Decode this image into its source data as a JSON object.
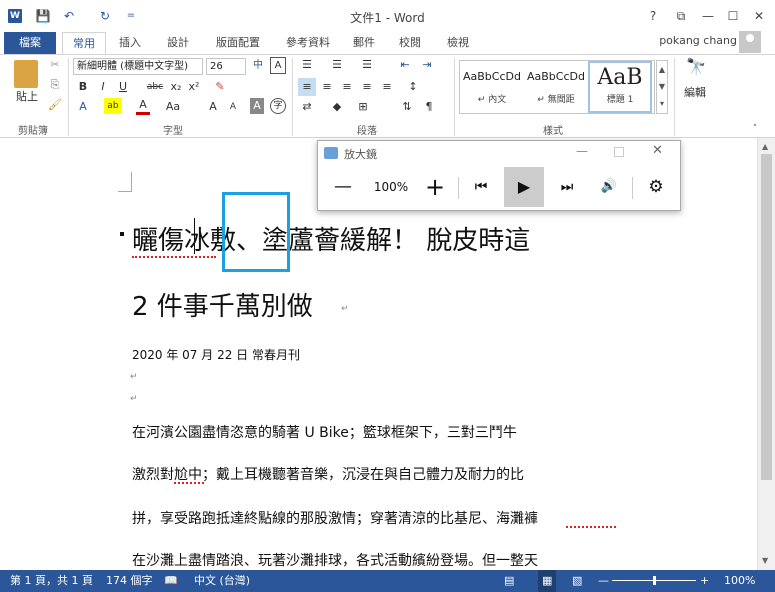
{
  "window": {
    "title": "文件1 - Word",
    "help": "?",
    "controls": [
      "⧉",
      "—",
      "☐",
      "✕"
    ]
  },
  "qat": [
    "💾",
    "↶",
    "↻",
    "="
  ],
  "ribbon_tabs": {
    "file": "檔案",
    "tabs": [
      "常用",
      "插入",
      "設計",
      "版面配置",
      "參考資料",
      "郵件",
      "校閱",
      "檢視"
    ],
    "user": "pokang chang"
  },
  "ribbon": {
    "clipboard": {
      "paste": "貼上",
      "label": "剪貼簿"
    },
    "font": {
      "name": "新細明體 (標題中文字型)",
      "size": "26",
      "label": "字型",
      "row2": [
        "B",
        "I",
        "U",
        "abc",
        "x₂",
        "x²",
        "✎"
      ],
      "row3": [
        "A",
        "ab",
        "A",
        "Aa",
        "A",
        "A",
        "A",
        "字"
      ]
    },
    "paragraph": {
      "label": "段落"
    },
    "styles": {
      "label": "樣式",
      "items": [
        {
          "sample": "AaBbCcDd",
          "name": "↵ 內文"
        },
        {
          "sample": "AaBbCcDd",
          "name": "↵ 無間距"
        },
        {
          "sample": "AaB",
          "name": "標題 1"
        }
      ]
    },
    "editing": {
      "label": "編輯"
    }
  },
  "document": {
    "heading_line1": "曬傷冰敷、塗蘆薈緩解！ 脫皮時這",
    "heading_line2": "2 件事千萬別做",
    "date_line": "2020 年 07 月 22 日 常春月刊",
    "paragraphs": [
      "在河濱公園盡情恣意的騎著 U Bike；籃球框架下，三對三鬥牛",
      "激烈對尬中；戴上耳機聽著音樂，沉浸在與自己體力及耐力的比",
      "拼，享受路跑抵達終點線的那股激情；穿著清涼的比基尼、海灘褲",
      "在沙灘上盡情踏浪、玩著沙灘排球，各式活動繽紛登場。但一整天"
    ],
    "para_mark": "↵"
  },
  "magnifier": {
    "title": "放大鏡",
    "zoom": "100%",
    "minus": "—",
    "plus": "+",
    "controls": [
      "⏮",
      "▶",
      "⏭",
      "🔊",
      "⚙"
    ]
  },
  "status": {
    "page": "第 1 頁，共 1 頁",
    "words": "174 個字",
    "language": "中文 (台灣)",
    "zoom": "100%",
    "zoom_level": 0.5
  },
  "colors": {
    "accent": "#2b579a",
    "highlight": "#1ba1e2"
  }
}
